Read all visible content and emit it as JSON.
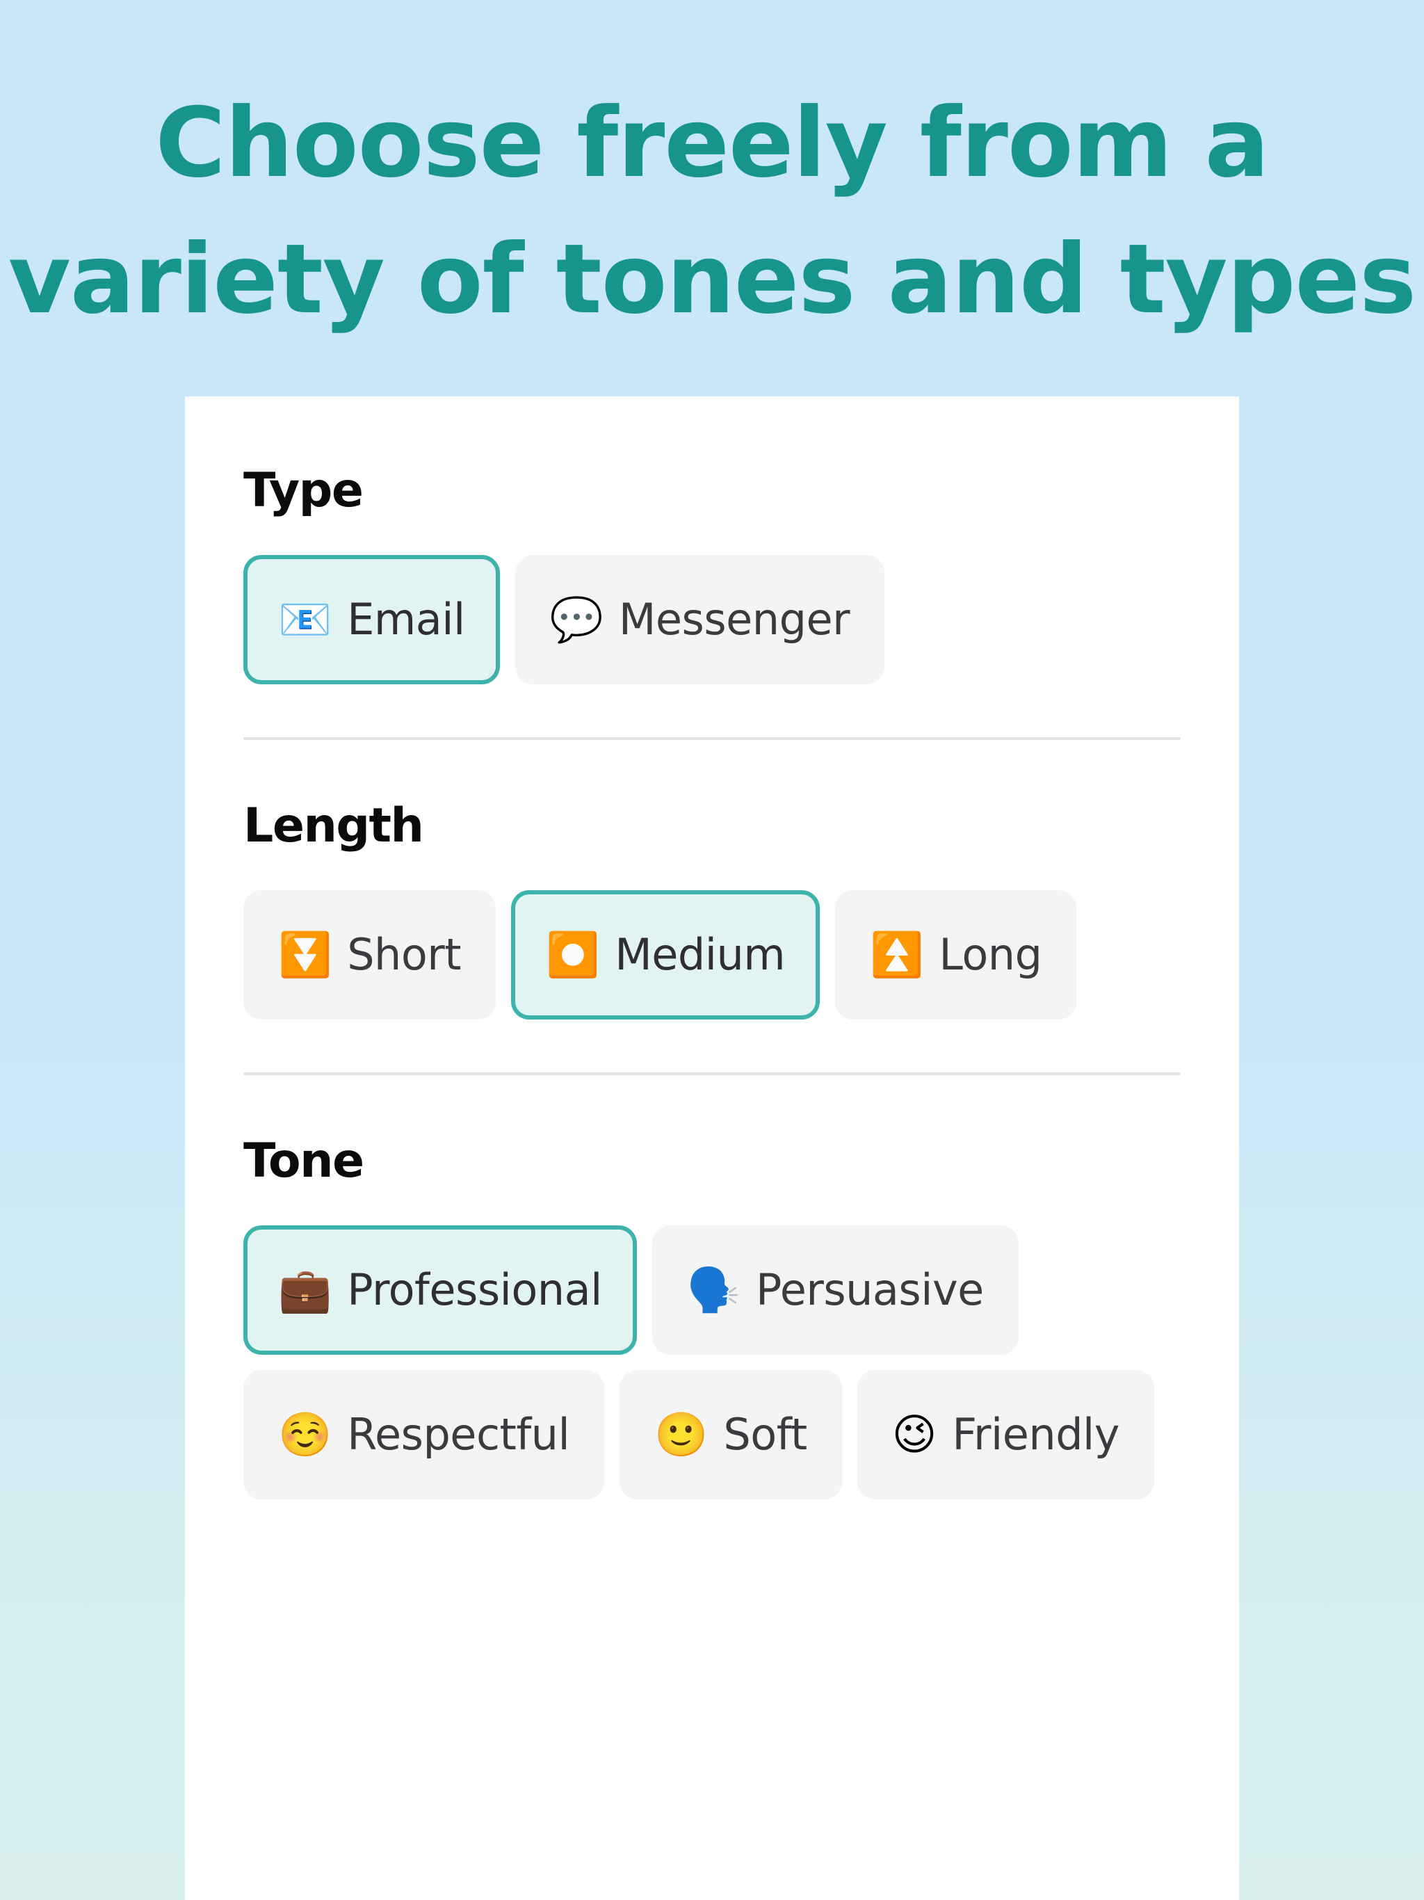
{
  "headline": "Choose freely from a\nvariety of tones and types",
  "colors": {
    "page_background": "#c9e7f7",
    "headline_text": "#17948b",
    "card_background": "#ffffff",
    "selected_border": "#3db3ab",
    "selected_background": "#e2f4f1",
    "option_background": "#f4f4f5",
    "option_label": "#3b3b3f",
    "section_title": "#0b0b0b",
    "divider": "#e2e2e4"
  },
  "sections": [
    {
      "title": "Type",
      "options": [
        {
          "label": "Email",
          "emoji": "📧",
          "icon_name": "email-emoji",
          "selected": true
        },
        {
          "label": "Messenger",
          "emoji": "💬",
          "icon_name": "speech-balloon-emoji",
          "selected": false
        }
      ],
      "has_divider_after": true
    },
    {
      "title": "Length",
      "options": [
        {
          "label": "Short",
          "emoji": "⏬",
          "icon_name": "fast-down-arrow-emoji",
          "selected": false
        },
        {
          "label": "Medium",
          "emoji": "⏺️",
          "icon_name": "record-button-emoji",
          "selected": true
        },
        {
          "label": "Long",
          "emoji": "⏫",
          "icon_name": "fast-up-arrow-emoji",
          "selected": false
        }
      ],
      "has_divider_after": true
    },
    {
      "title": "Tone",
      "options": [
        {
          "label": "Professional",
          "emoji": "💼",
          "icon_name": "briefcase-emoji",
          "selected": true
        },
        {
          "label": "Persuasive",
          "emoji": "🗣️",
          "icon_name": "speaking-head-emoji",
          "selected": false
        },
        {
          "label": "Respectful",
          "emoji": "☺️",
          "icon_name": "smiling-face-emoji",
          "selected": false
        },
        {
          "label": "Soft",
          "emoji": "🙂",
          "icon_name": "slightly-smiling-face-emoji",
          "selected": false
        },
        {
          "label": "Friendly",
          "emoji": "😉",
          "icon_name": "winking-face-emoji",
          "selected": false
        }
      ],
      "has_divider_after": false
    }
  ]
}
